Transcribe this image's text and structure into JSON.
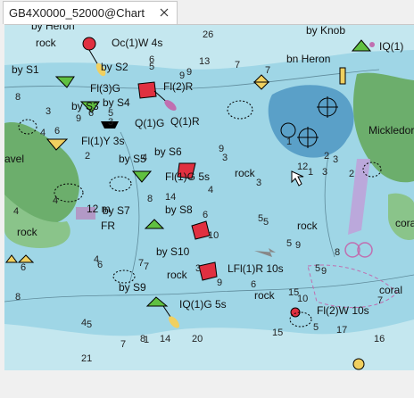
{
  "tab": {
    "title": "GB4X0000_52000@Chart",
    "close_icon": "close-icon"
  },
  "chart": {
    "colors": {
      "shallow": "#9fd6e6",
      "deep": "#c4e7ef",
      "land": "#6cae6c",
      "drying": "#8ac48a",
      "magenta": "#c0a0d8",
      "depth_blue": "#5aa0c8"
    },
    "buoy_names": [
      "by S1",
      "by S2",
      "by S3",
      "by S4",
      "by S5",
      "by S6",
      "by S7",
      "by S8",
      "by S9",
      "by S10",
      "by Heron",
      "by Knob"
    ],
    "light_labels": [
      "Oc(1)W 4s",
      "Fl(3)G",
      "Fl(2)R",
      "Q(1)G",
      "Q(1)R",
      "Fl(1)Y 3s",
      "Fl(1)G 5s",
      "LFl(1)R 10s",
      "IQ(1)G 5s",
      "Fl(2)W 10s",
      "IQ(1)"
    ],
    "place_names": [
      "bn Heron",
      "Mickledor",
      "avel",
      "FR",
      "12 m",
      "coral",
      "cora"
    ],
    "rock_labels": [
      "rock",
      "rock",
      "rock",
      "rock",
      "rock",
      "rock"
    ],
    "soundings": [
      "26",
      "13",
      "7",
      "7",
      "5",
      "6",
      "8",
      "9",
      "9",
      "3",
      "4",
      "6",
      "9",
      "3",
      "5",
      "6",
      "4",
      "9",
      "3",
      "3",
      "4",
      "14",
      "2",
      "8",
      "6",
      "10",
      "4",
      "4",
      "5",
      "5",
      "5",
      "9",
      "4",
      "6",
      "7",
      "7",
      "3",
      "9",
      "6",
      "8",
      "4",
      "5",
      "7",
      "8",
      "1",
      "6",
      "10",
      "15",
      "5",
      "14",
      "16",
      "20",
      "21",
      "17",
      "5",
      "9",
      "8",
      "7",
      "2",
      "3",
      "2",
      "12",
      "1",
      "3",
      "1",
      "15"
    ]
  }
}
